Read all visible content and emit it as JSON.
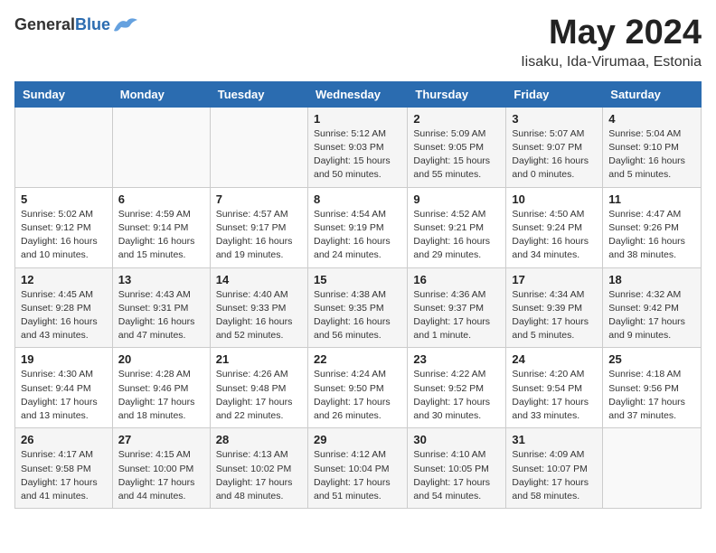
{
  "header": {
    "logo_general": "General",
    "logo_blue": "Blue",
    "month": "May 2024",
    "location": "Iisaku, Ida-Virumaa, Estonia"
  },
  "weekdays": [
    "Sunday",
    "Monday",
    "Tuesday",
    "Wednesday",
    "Thursday",
    "Friday",
    "Saturday"
  ],
  "weeks": [
    [
      {
        "day": "",
        "info": ""
      },
      {
        "day": "",
        "info": ""
      },
      {
        "day": "",
        "info": ""
      },
      {
        "day": "1",
        "info": "Sunrise: 5:12 AM\nSunset: 9:03 PM\nDaylight: 15 hours\nand 50 minutes."
      },
      {
        "day": "2",
        "info": "Sunrise: 5:09 AM\nSunset: 9:05 PM\nDaylight: 15 hours\nand 55 minutes."
      },
      {
        "day": "3",
        "info": "Sunrise: 5:07 AM\nSunset: 9:07 PM\nDaylight: 16 hours\nand 0 minutes."
      },
      {
        "day": "4",
        "info": "Sunrise: 5:04 AM\nSunset: 9:10 PM\nDaylight: 16 hours\nand 5 minutes."
      }
    ],
    [
      {
        "day": "5",
        "info": "Sunrise: 5:02 AM\nSunset: 9:12 PM\nDaylight: 16 hours\nand 10 minutes."
      },
      {
        "day": "6",
        "info": "Sunrise: 4:59 AM\nSunset: 9:14 PM\nDaylight: 16 hours\nand 15 minutes."
      },
      {
        "day": "7",
        "info": "Sunrise: 4:57 AM\nSunset: 9:17 PM\nDaylight: 16 hours\nand 19 minutes."
      },
      {
        "day": "8",
        "info": "Sunrise: 4:54 AM\nSunset: 9:19 PM\nDaylight: 16 hours\nand 24 minutes."
      },
      {
        "day": "9",
        "info": "Sunrise: 4:52 AM\nSunset: 9:21 PM\nDaylight: 16 hours\nand 29 minutes."
      },
      {
        "day": "10",
        "info": "Sunrise: 4:50 AM\nSunset: 9:24 PM\nDaylight: 16 hours\nand 34 minutes."
      },
      {
        "day": "11",
        "info": "Sunrise: 4:47 AM\nSunset: 9:26 PM\nDaylight: 16 hours\nand 38 minutes."
      }
    ],
    [
      {
        "day": "12",
        "info": "Sunrise: 4:45 AM\nSunset: 9:28 PM\nDaylight: 16 hours\nand 43 minutes."
      },
      {
        "day": "13",
        "info": "Sunrise: 4:43 AM\nSunset: 9:31 PM\nDaylight: 16 hours\nand 47 minutes."
      },
      {
        "day": "14",
        "info": "Sunrise: 4:40 AM\nSunset: 9:33 PM\nDaylight: 16 hours\nand 52 minutes."
      },
      {
        "day": "15",
        "info": "Sunrise: 4:38 AM\nSunset: 9:35 PM\nDaylight: 16 hours\nand 56 minutes."
      },
      {
        "day": "16",
        "info": "Sunrise: 4:36 AM\nSunset: 9:37 PM\nDaylight: 17 hours\nand 1 minute."
      },
      {
        "day": "17",
        "info": "Sunrise: 4:34 AM\nSunset: 9:39 PM\nDaylight: 17 hours\nand 5 minutes."
      },
      {
        "day": "18",
        "info": "Sunrise: 4:32 AM\nSunset: 9:42 PM\nDaylight: 17 hours\nand 9 minutes."
      }
    ],
    [
      {
        "day": "19",
        "info": "Sunrise: 4:30 AM\nSunset: 9:44 PM\nDaylight: 17 hours\nand 13 minutes."
      },
      {
        "day": "20",
        "info": "Sunrise: 4:28 AM\nSunset: 9:46 PM\nDaylight: 17 hours\nand 18 minutes."
      },
      {
        "day": "21",
        "info": "Sunrise: 4:26 AM\nSunset: 9:48 PM\nDaylight: 17 hours\nand 22 minutes."
      },
      {
        "day": "22",
        "info": "Sunrise: 4:24 AM\nSunset: 9:50 PM\nDaylight: 17 hours\nand 26 minutes."
      },
      {
        "day": "23",
        "info": "Sunrise: 4:22 AM\nSunset: 9:52 PM\nDaylight: 17 hours\nand 30 minutes."
      },
      {
        "day": "24",
        "info": "Sunrise: 4:20 AM\nSunset: 9:54 PM\nDaylight: 17 hours\nand 33 minutes."
      },
      {
        "day": "25",
        "info": "Sunrise: 4:18 AM\nSunset: 9:56 PM\nDaylight: 17 hours\nand 37 minutes."
      }
    ],
    [
      {
        "day": "26",
        "info": "Sunrise: 4:17 AM\nSunset: 9:58 PM\nDaylight: 17 hours\nand 41 minutes."
      },
      {
        "day": "27",
        "info": "Sunrise: 4:15 AM\nSunset: 10:00 PM\nDaylight: 17 hours\nand 44 minutes."
      },
      {
        "day": "28",
        "info": "Sunrise: 4:13 AM\nSunset: 10:02 PM\nDaylight: 17 hours\nand 48 minutes."
      },
      {
        "day": "29",
        "info": "Sunrise: 4:12 AM\nSunset: 10:04 PM\nDaylight: 17 hours\nand 51 minutes."
      },
      {
        "day": "30",
        "info": "Sunrise: 4:10 AM\nSunset: 10:05 PM\nDaylight: 17 hours\nand 54 minutes."
      },
      {
        "day": "31",
        "info": "Sunrise: 4:09 AM\nSunset: 10:07 PM\nDaylight: 17 hours\nand 58 minutes."
      },
      {
        "day": "",
        "info": ""
      }
    ]
  ]
}
